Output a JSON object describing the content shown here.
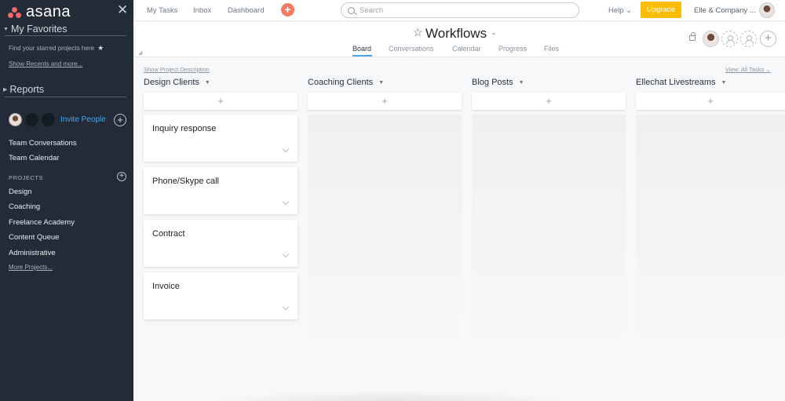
{
  "sidebar": {
    "logo_text": "asana",
    "favorites_title": "My Favorites",
    "favorites_hint": "Find your starred projects here",
    "show_recents": "Show Recents and more...",
    "reports_title": "Reports",
    "invite_label": "Invite People",
    "links": [
      "Team Conversations",
      "Team Calendar"
    ],
    "projects_label": "PROJECTS",
    "projects": [
      "Design",
      "Coaching",
      "Freelance Academy",
      "Content Queue",
      "Administrative"
    ],
    "more_projects": "More Projects..."
  },
  "topbar": {
    "nav": [
      "My Tasks",
      "Inbox",
      "Dashboard"
    ],
    "search_placeholder": "Search",
    "help_label": "Help ⌄",
    "upgrade_label": "Upgrade",
    "org_label": "Elle & Company ..."
  },
  "project": {
    "title": "Workflows",
    "tabs": [
      "Board",
      "Conversations",
      "Calendar",
      "Progress",
      "Files"
    ],
    "active_tab": "Board"
  },
  "board": {
    "show_description": "Show Project Description",
    "view_label": "View: All Tasks ⌄",
    "columns": [
      {
        "name": "Design Clients",
        "cards": [
          "Inquiry response",
          "Phone/Skype call",
          "Contract",
          "Invoice"
        ]
      },
      {
        "name": "Coaching Clients",
        "cards": []
      },
      {
        "name": "Blog Posts",
        "cards": []
      },
      {
        "name": "Ellechat Livestreams",
        "cards": []
      }
    ]
  },
  "colors": {
    "sidebar_bg": "#222b37",
    "accent_blue": "#4aa5e6",
    "upgrade_yellow": "#fcbd01",
    "logo_coral": "#f06a6a"
  }
}
